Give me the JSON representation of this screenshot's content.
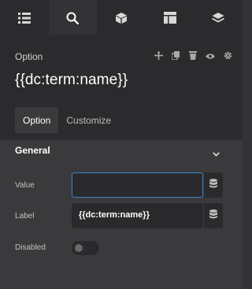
{
  "topbar": {
    "tabs": [
      {
        "icon": "list-icon",
        "active": false
      },
      {
        "icon": "search-icon",
        "active": true
      },
      {
        "icon": "cube-icon",
        "active": false
      },
      {
        "icon": "layout-icon",
        "active": false
      },
      {
        "icon": "layers-icon",
        "active": false
      }
    ]
  },
  "header": {
    "element_type": "Option",
    "element_title": "{{dc:term:name}}",
    "actions": [
      "move-icon",
      "copy-icon",
      "trash-icon",
      "eye-icon",
      "gear-icon"
    ],
    "subtabs": [
      {
        "label": "Option",
        "active": true
      },
      {
        "label": "Customize",
        "active": false
      }
    ]
  },
  "section": {
    "title": "General",
    "fields": {
      "value": {
        "label": "Value",
        "value": ""
      },
      "label": {
        "label": "Label",
        "value": "{{dc:term:name}}"
      },
      "disabled": {
        "label": "Disabled",
        "on": false
      }
    }
  },
  "colors": {
    "accent": "#3a82c9",
    "panel": "#333335",
    "header": "#2b2b2d"
  }
}
